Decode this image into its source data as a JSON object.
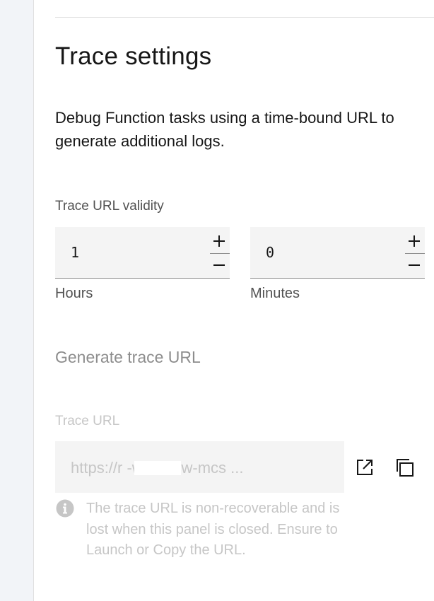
{
  "panel": {
    "title": "Trace settings",
    "description": "Debug Function tasks using a time-bound URL to generate additional logs."
  },
  "validity": {
    "label": "Trace URL validity",
    "hours": {
      "value": "1",
      "helper": "Hours"
    },
    "minutes": {
      "value": "0",
      "helper": "Minutes"
    },
    "increment_symbol": "+",
    "decrement_symbol": "−"
  },
  "generate": {
    "label": "Generate trace URL"
  },
  "trace_url": {
    "label": "Trace URL",
    "value": "https://r          -workflow-mcs ..."
  },
  "icons": {
    "launch": "launch-icon",
    "copy": "copy-icon",
    "info": "info-icon"
  },
  "info": {
    "text": "The trace URL is non-recoverable and is lost when this panel is closed. Ensure to Launch or Copy the URL."
  },
  "colors": {
    "text_primary": "#161616",
    "text_secondary": "#525252",
    "text_disabled": "#c6c6c6",
    "field_bg": "#f4f4f4",
    "rail_bg": "#f2f4f8"
  }
}
